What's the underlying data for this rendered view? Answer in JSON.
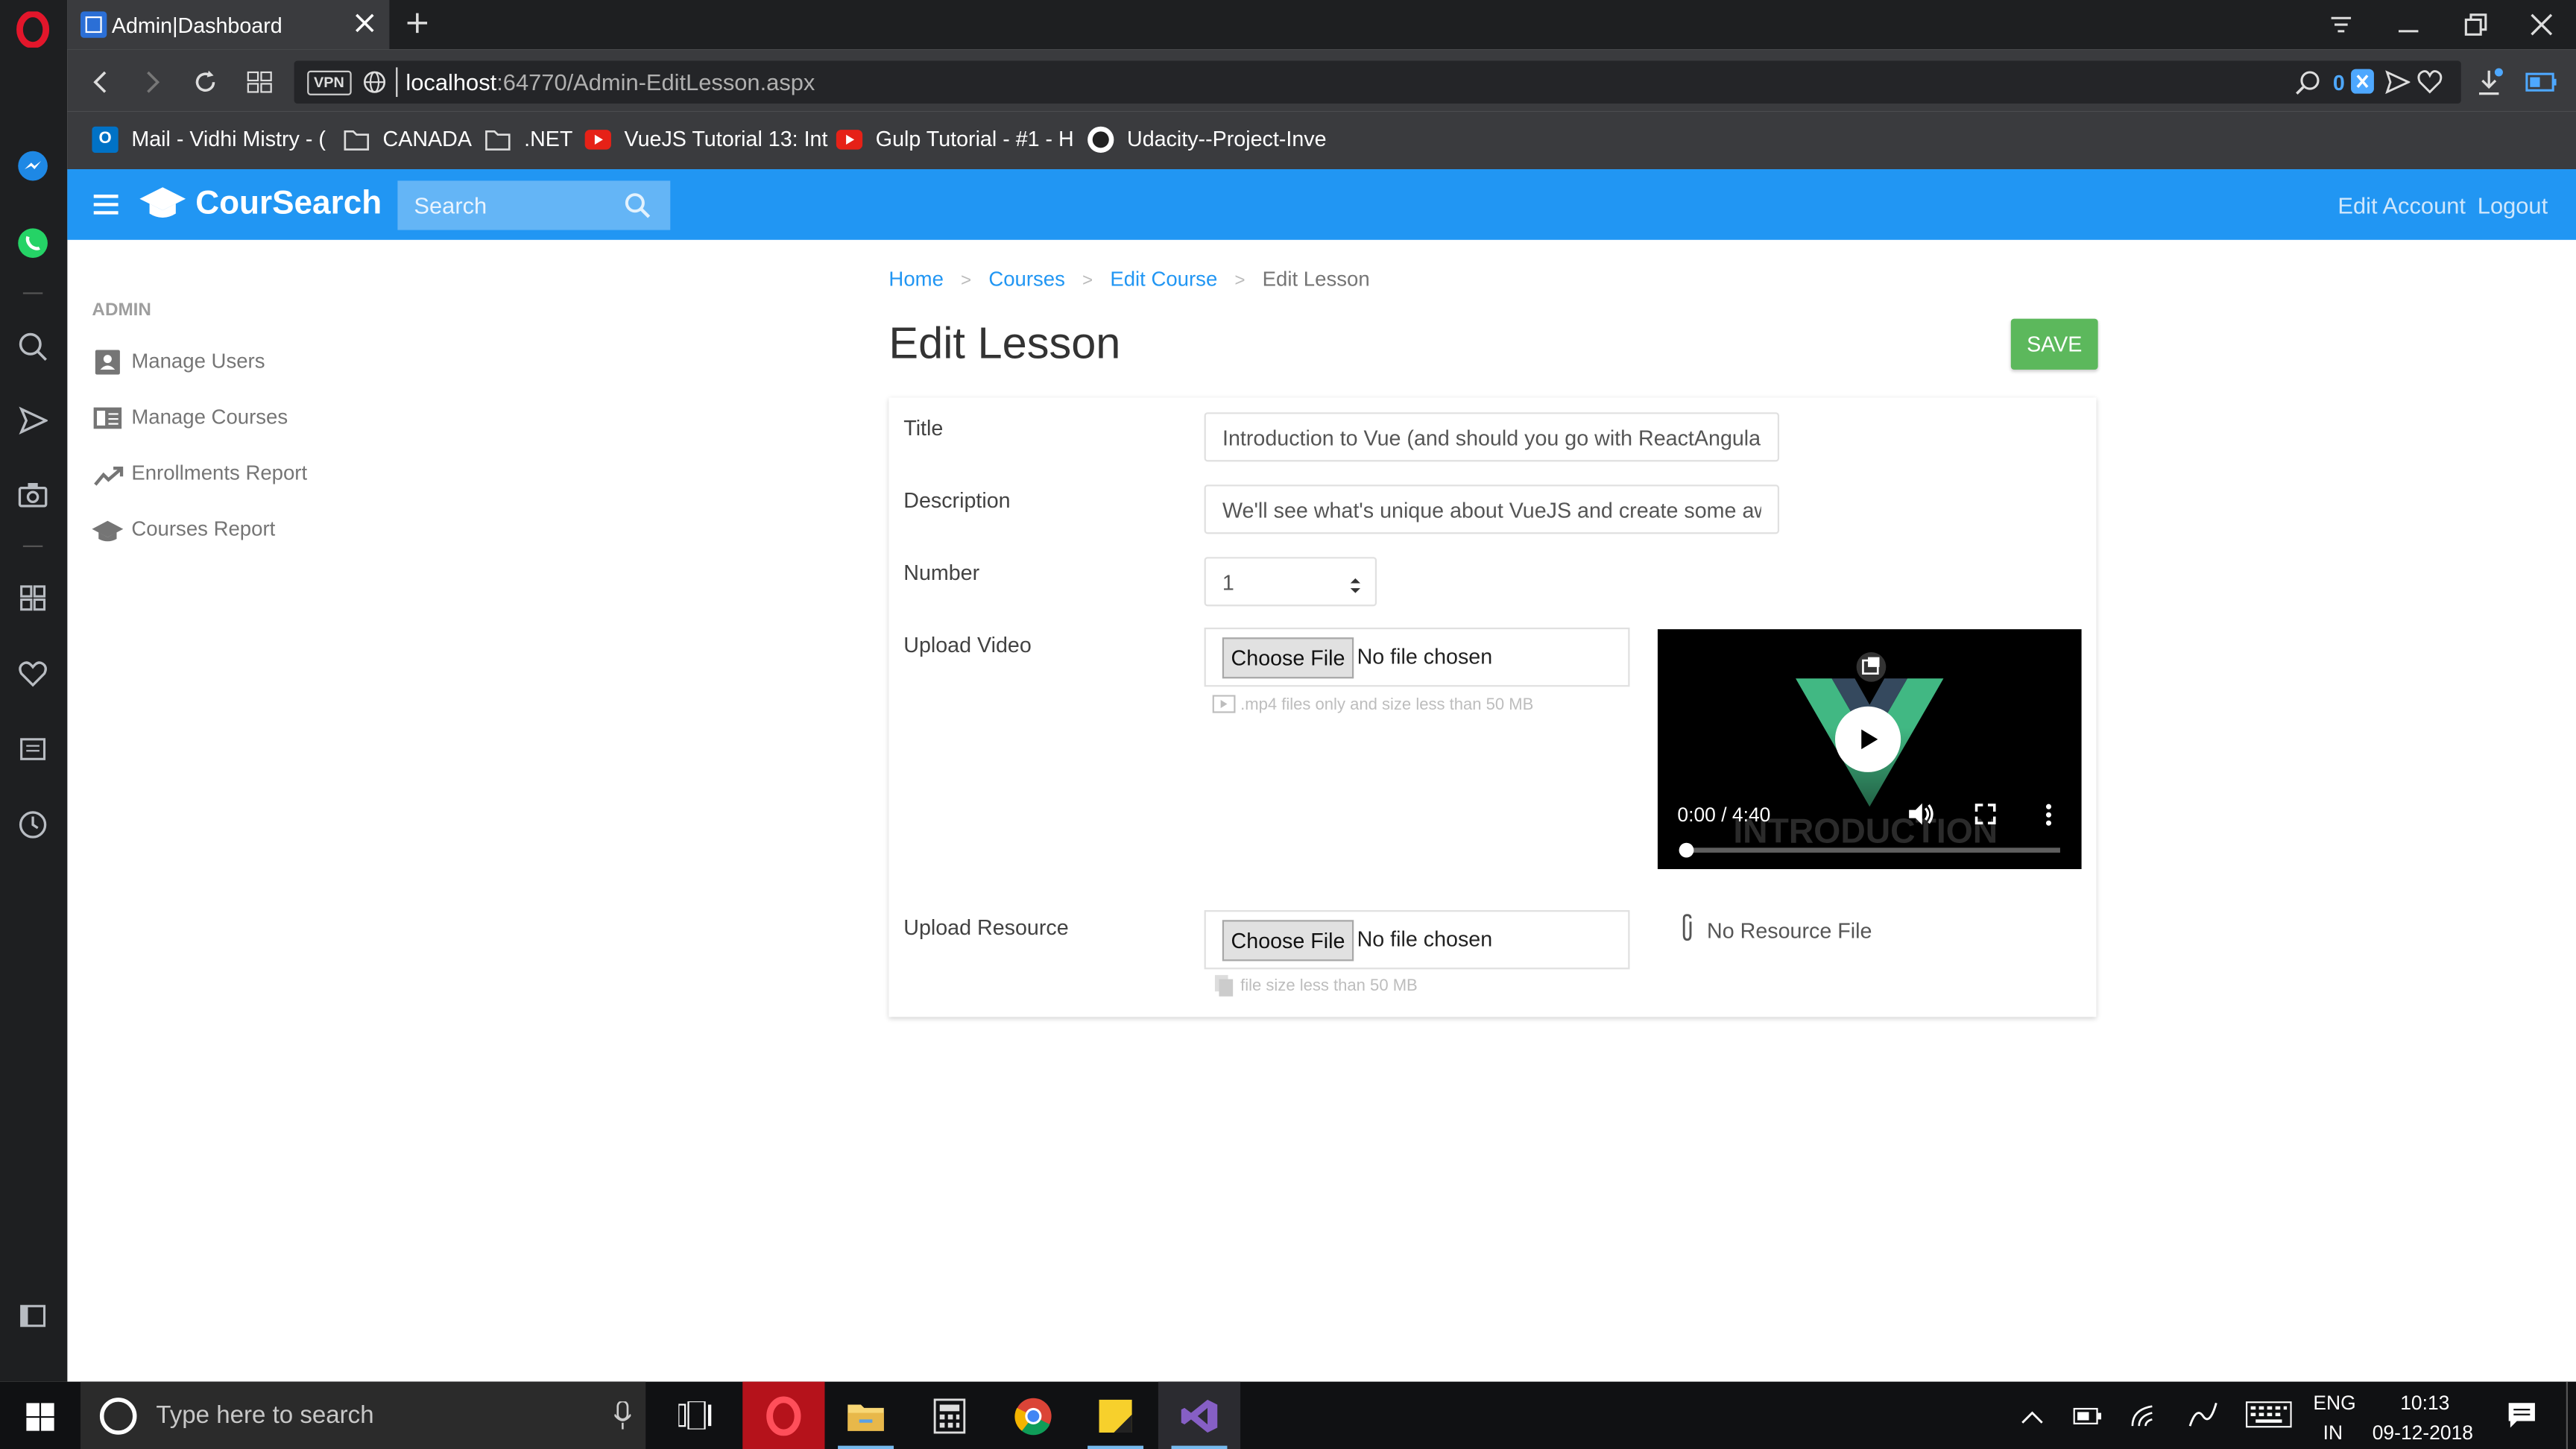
{
  "browser": {
    "tab_title": "Admin|Dashboard",
    "url_host": "localhost",
    "url_rest": ":64770/Admin-EditLesson.aspx",
    "vpn_label": "VPN",
    "ad_count": "0",
    "bookmarks": [
      {
        "label": "Mail - Vidhi Mistry - (",
        "icon": "outlook-icon"
      },
      {
        "label": "CANADA",
        "icon": "folder-icon"
      },
      {
        "label": ".NET",
        "icon": "folder-icon"
      },
      {
        "label": "VueJS Tutorial 13: Int",
        "icon": "youtube-icon"
      },
      {
        "label": "Gulp Tutorial - #1 - H",
        "icon": "youtube-icon"
      },
      {
        "label": "Udacity--Project-Inve",
        "icon": "github-icon"
      }
    ]
  },
  "app": {
    "brand": "CourSearch",
    "search_placeholder": "Search",
    "header_links": {
      "edit_account": "Edit Account",
      "logout": "Logout"
    }
  },
  "sidebar": {
    "section": "ADMIN",
    "items": [
      {
        "label": "Manage Users",
        "icon": "user-icon"
      },
      {
        "label": "Manage Courses",
        "icon": "courses-icon"
      },
      {
        "label": "Enrollments Report",
        "icon": "trending-icon"
      },
      {
        "label": "Courses Report",
        "icon": "graduation-cap-icon"
      }
    ]
  },
  "breadcrumb": {
    "home": "Home",
    "courses": "Courses",
    "edit_course": "Edit Course",
    "current": "Edit Lesson",
    "separator": ">"
  },
  "page": {
    "title": "Edit Lesson",
    "save_label": "SAVE"
  },
  "form": {
    "title_label": "Title",
    "title_value": "Introduction to Vue (and should you go with ReactAngular",
    "description_label": "Description",
    "description_value": "We'll see what's unique about VueJS and create some awe",
    "number_label": "Number",
    "number_value": "1",
    "upload_video_label": "Upload Video",
    "choose_file": "Choose File",
    "no_file": "No file chosen",
    "video_hint": ".mp4 files only and size less than 50 MB",
    "upload_resource_label": "Upload Resource",
    "resource_hint": "file size less than 50 MB",
    "no_resource": "No Resource File"
  },
  "video": {
    "time": "0:00 / 4:40",
    "overlay_text": "INTRODUCTION",
    "progress": 0
  },
  "taskbar": {
    "search_placeholder": "Type here to search",
    "lang": "ENG",
    "region": "IN",
    "time": "10:13",
    "date": "09-12-2018"
  },
  "colors": {
    "primary": "#2196f3",
    "save": "#5cb85c",
    "opera_red": "#e3162b",
    "link": "#2196f3"
  }
}
